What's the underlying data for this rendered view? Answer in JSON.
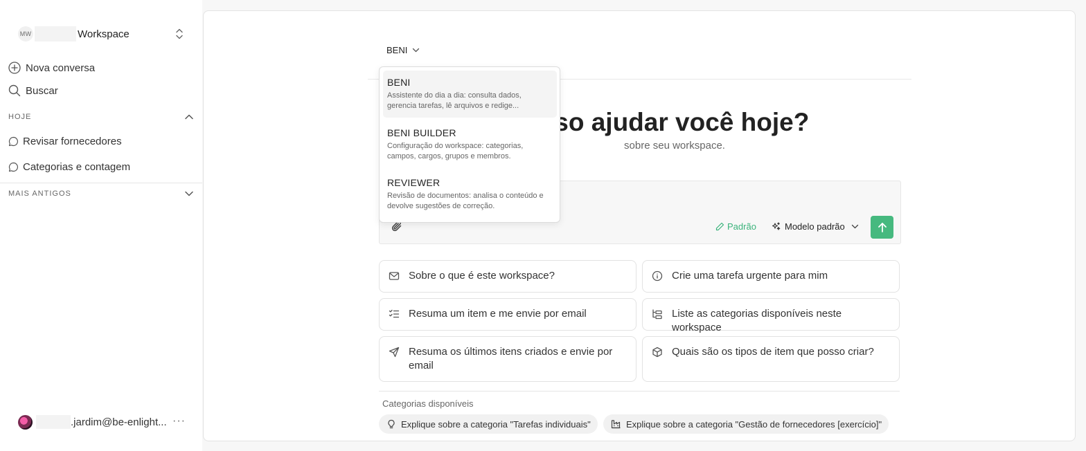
{
  "sidebar": {
    "workspace": {
      "initials": "MW",
      "name": "Workspace"
    },
    "new_chat": "Nova conversa",
    "search": "Buscar",
    "today_label": "HOJE",
    "conversations": [
      "Revisar fornecedores",
      "Categorias e contagem"
    ],
    "older_label": "MAIS ANTIGOS",
    "user_email": ".jardim@be-enlight...",
    "more": "···"
  },
  "main": {
    "agent_selected": "BENI",
    "hero_title": "sso ajudar você hoje?",
    "hero_subtitle": "sobre seu workspace.",
    "composer": {
      "style_label": "Padrão",
      "model_label": "Modelo padrão"
    },
    "suggestions": [
      {
        "icon": "mail-icon",
        "text": "Sobre o que é este workspace?"
      },
      {
        "icon": "info-icon",
        "text": "Crie uma tarefa urgente para mim"
      },
      {
        "icon": "checklist-icon",
        "text": "Resuma um item e me envie por email"
      },
      {
        "icon": "folder-tree-icon",
        "text": "Liste as categorias disponíveis neste workspace"
      },
      {
        "icon": "send-icon",
        "text": "Resuma os últimos itens criados e envie por email"
      },
      {
        "icon": "box-icon",
        "text": "Quais são os tipos de item que posso criar?"
      }
    ],
    "categories_heading": "Categorias disponíveis",
    "category_chips": [
      "Explique sobre a categoria \"Tarefas individuais\"",
      "Explique sobre a categoria \"Gestão de fornecedores [exercício]\""
    ]
  },
  "dropdown": {
    "options": [
      {
        "name": "BENI",
        "description": "Assistente do dia a dia: consulta dados, gerencia tarefas, lê arquivos e redige..."
      },
      {
        "name": "BENI BUILDER",
        "description": "Configuração do workspace: categorias, campos, cargos, grupos e membros."
      },
      {
        "name": "REVIEWER",
        "description": "Revisão de documentos: analisa o conteúdo e devolve sugestões de correção."
      }
    ]
  },
  "colors": {
    "accent": "#46b97f",
    "accent_text": "#3bb37b"
  }
}
